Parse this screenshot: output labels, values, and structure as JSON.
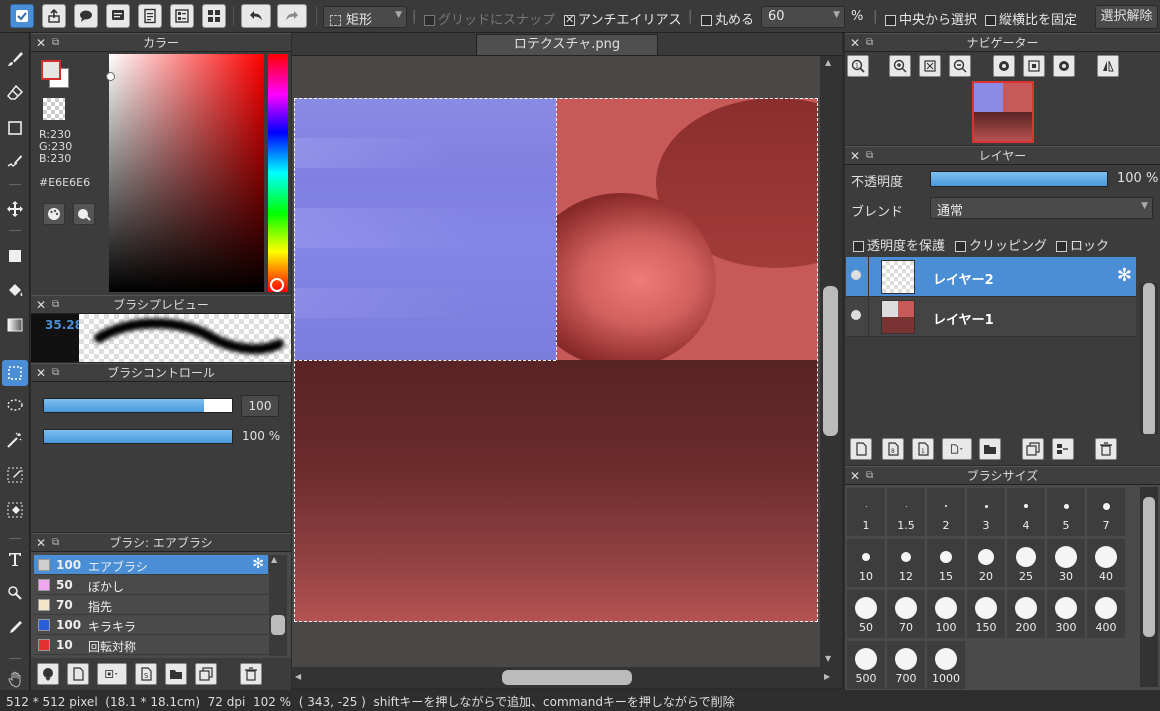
{
  "window": {
    "document_tab": "ロテクスチャ.png"
  },
  "toolbar": {
    "selection_shape": "矩形",
    "grid_snap_label": "グリッドにスナップ",
    "antialias_label": "アンチエイリアス",
    "round_label": "丸める",
    "round_value": "60",
    "percent": "%",
    "from_center_label": "中央から選択",
    "keep_ratio_label": "縦横比を固定",
    "deselect_label": "選択解除"
  },
  "color_panel": {
    "title": "カラー",
    "r": "R:230",
    "g": "G:230",
    "b": "B:230",
    "hex": "#E6E6E6",
    "fg_color": "#e6e6e6"
  },
  "brush_preview": {
    "title": "ブラシプレビュー",
    "size": "35.28"
  },
  "brush_control": {
    "title": "ブラシコントロール",
    "size_value": "100",
    "opacity_value": "100 %",
    "size_fraction": 0.85,
    "opacity_fraction": 1.0
  },
  "brush_list": {
    "title": "ブラシ: エアブラシ",
    "items": [
      {
        "value": "100",
        "name": "エアブラシ",
        "color": "#cfcfcf",
        "selected": true
      },
      {
        "value": "50",
        "name": "ぼかし",
        "color": "#f0a8f0",
        "selected": false
      },
      {
        "value": "70",
        "name": "指先",
        "color": "#f3e6c8",
        "selected": false
      },
      {
        "value": "100",
        "name": "キラキラ",
        "color": "#2a5ed8",
        "selected": false
      },
      {
        "value": "10",
        "name": "回転対称",
        "color": "#e03030",
        "selected": false
      }
    ]
  },
  "navigator": {
    "title": "ナビゲーター"
  },
  "layers": {
    "title": "レイヤー",
    "opacity_label": "不透明度",
    "opacity_value": "100 %",
    "blend_label": "ブレンド",
    "blend_value": "通常",
    "protect_alpha_label": "透明度を保護",
    "clipping_label": "クリッピング",
    "lock_label": "ロック",
    "items": [
      {
        "name": "レイヤー2",
        "selected": true
      },
      {
        "name": "レイヤー1",
        "selected": false
      }
    ]
  },
  "brush_size": {
    "title": "ブラシサイズ",
    "sizes": [
      "1",
      "1.5",
      "2",
      "3",
      "4",
      "5",
      "7",
      "10",
      "12",
      "15",
      "20",
      "25",
      "30",
      "40",
      "50",
      "70",
      "100",
      "150",
      "200",
      "300",
      "400",
      "500",
      "700",
      "1000"
    ]
  },
  "status": {
    "size": "512 * 512 pixel",
    "cm": "(18.1 * 18.1cm)",
    "dpi": "72 dpi",
    "zoom": "102 %",
    "coords": "( 343, -25 )",
    "hint": "shiftキーを押しながらで追加、commandキーを押しながらで削除"
  }
}
